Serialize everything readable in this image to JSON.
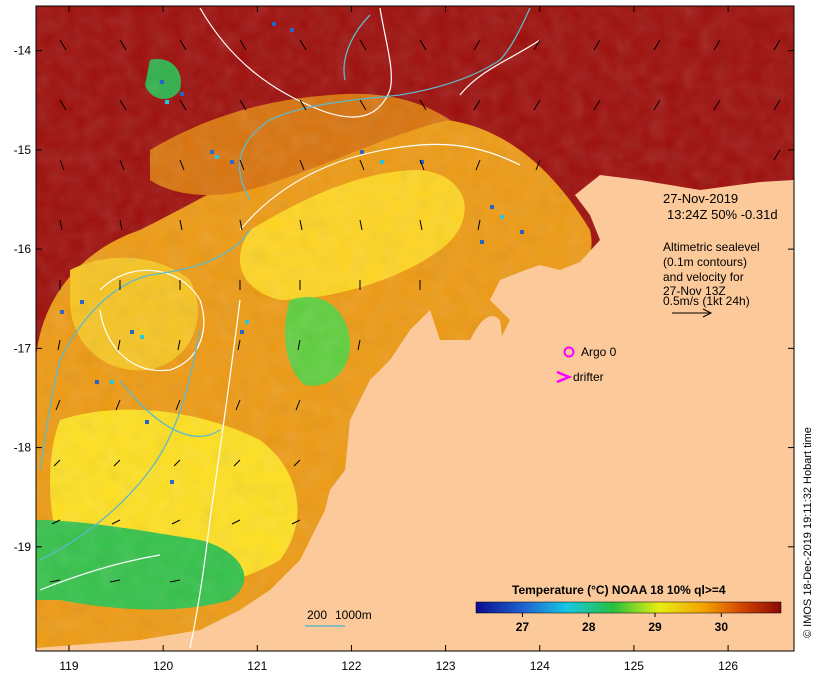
{
  "map": {
    "lon_range": [
      118.65,
      126.7
    ],
    "lat_range": [
      -20.05,
      -13.55
    ],
    "lon_ticks": [
      "119",
      "120",
      "121",
      "122",
      "123",
      "124",
      "125",
      "126"
    ],
    "lat_ticks": [
      "-14",
      "-15",
      "-16",
      "-17",
      "-18",
      "-19"
    ],
    "colors": {
      "land": "#fbc99a",
      "sst_hot": "#9e0e0b",
      "sst_mid": "#f0a010",
      "sst_warm": "#ffe020",
      "sst_cool": "#34c24a",
      "sst_cold": "#1c5ec8",
      "contour": "#ffffff",
      "depth_200": "#5fb9c8",
      "marker": "#ff00ff"
    }
  },
  "annotation": {
    "date_line": "27-Nov-2019",
    "time_line": "13:24Z  50% -0.31d",
    "note_lines": [
      "Altimetric sealevel",
      "(0.1m contours)",
      "and velocity for",
      "27-Nov 13Z",
      "0.5m/s (1kt 24h)"
    ]
  },
  "legend": {
    "argo_label": "Argo 0",
    "drifter_label": "drifter",
    "depth_200_label": "200",
    "depth_1000_label": "1000m"
  },
  "colorbar": {
    "title": "Temperature (°C) NOAA 18 10% ql>=4",
    "ticks": [
      "27",
      "28",
      "29",
      "30"
    ],
    "tick_values": [
      27,
      28,
      29,
      30
    ],
    "range": [
      26.3,
      30.9
    ]
  },
  "credit": "© IMOS 18-Dec-2019 19:11:32 Hobart time"
}
